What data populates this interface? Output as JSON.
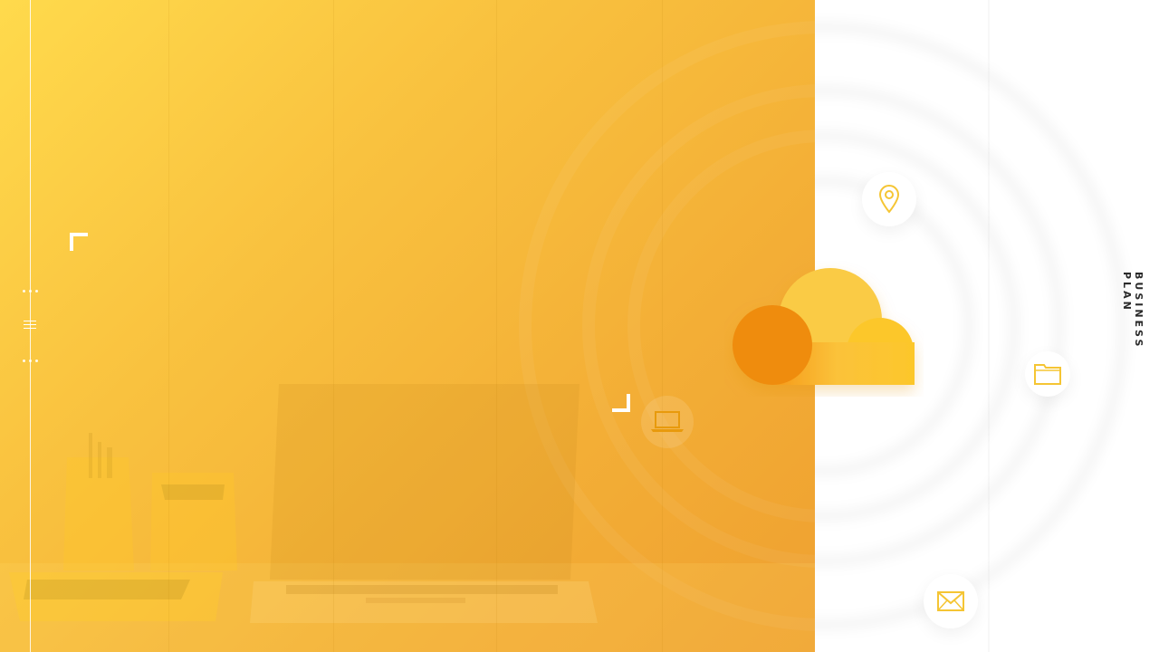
{
  "slide": {
    "vertical_label": "BUSINESS PLAN"
  },
  "colors": {
    "accent_yellow": "#FBC82D",
    "accent_orange": "#F0900F",
    "panel_start": "#FFDA4C",
    "panel_end": "#EFA030",
    "icon_stroke": "#F5C534"
  },
  "icons": {
    "location": "map-pin-icon",
    "folder": "folder-icon",
    "mail": "envelope-icon",
    "laptop": "laptop-icon",
    "cloud": "cloud-icon",
    "menu": "hamburger-menu-icon"
  }
}
